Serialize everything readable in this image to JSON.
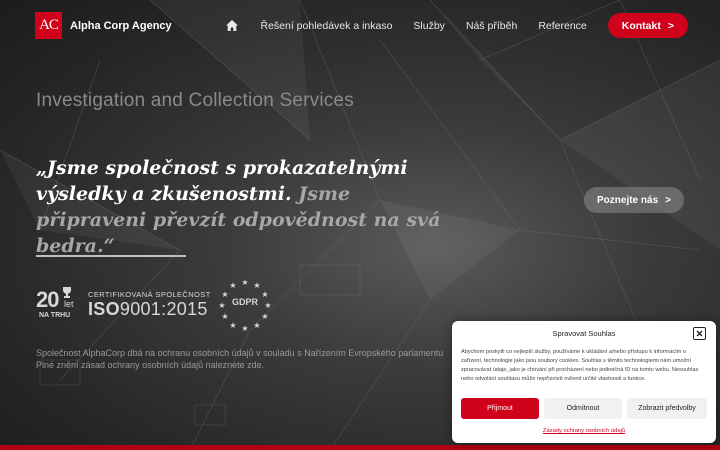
{
  "header": {
    "logo_mark": "AC",
    "logo_text": "Alpha Corp Agency",
    "nav": [
      "Řešení pohledávek a inkaso",
      "Služby",
      "Náš příběh",
      "Reference"
    ],
    "cta_label": "Kontakt",
    "cta_chevron": ">",
    "home_icon": "home-icon"
  },
  "hero": {
    "subtitle": "Investigation and Collection Services",
    "quote_main": "„Jsme společnost s prokazatelnými výsledky a zkušenostmi.",
    "quote_dim": "Jsme připraveni převzít odpovědnost na svá bedra.“",
    "more_button": "Poznejte nás",
    "more_chevron": ">"
  },
  "badges": {
    "years_number": "20",
    "years_unit": "let",
    "years_caption": "NA TRHU",
    "iso_caption": "CERTIFIKOVANÁ SPOLEČNOST",
    "iso_prefix": "ISO",
    "iso_number": "9001:2015",
    "gdpr_label": "GDPR"
  },
  "privacy": {
    "line1": "Společnost AlphaCorp dbá na ochranu osobních údajů v souladu s Nařízením Evropského parlamentu",
    "line2": "Plné znění zásad ochrany osobních údajů naleznete zde."
  },
  "consent": {
    "title": "Spravovat Souhlas",
    "text": "Abychom poskytli co nejlepší služby, používáme k ukládání a/nebo přístupu k informacím o zařízení, technologie jako jsou soubory cookies. Souhlas s těmito technologiemi nám umožní zpracovávat údaje, jako je chování při procházení nebo jedinečná ID na tomto webu. Nesouhlas nebo odvolání souhlasu může nepříznivě ovlivnit určité vlastnosti a funkce.",
    "accept": "Přijmout",
    "deny": "Odmítnout",
    "preferences": "Zobrazit předvolby",
    "policy_link": "Zásady ochrany osobních údajů"
  },
  "colors": {
    "accent": "#d0021b",
    "background": "#2a2a2a"
  }
}
